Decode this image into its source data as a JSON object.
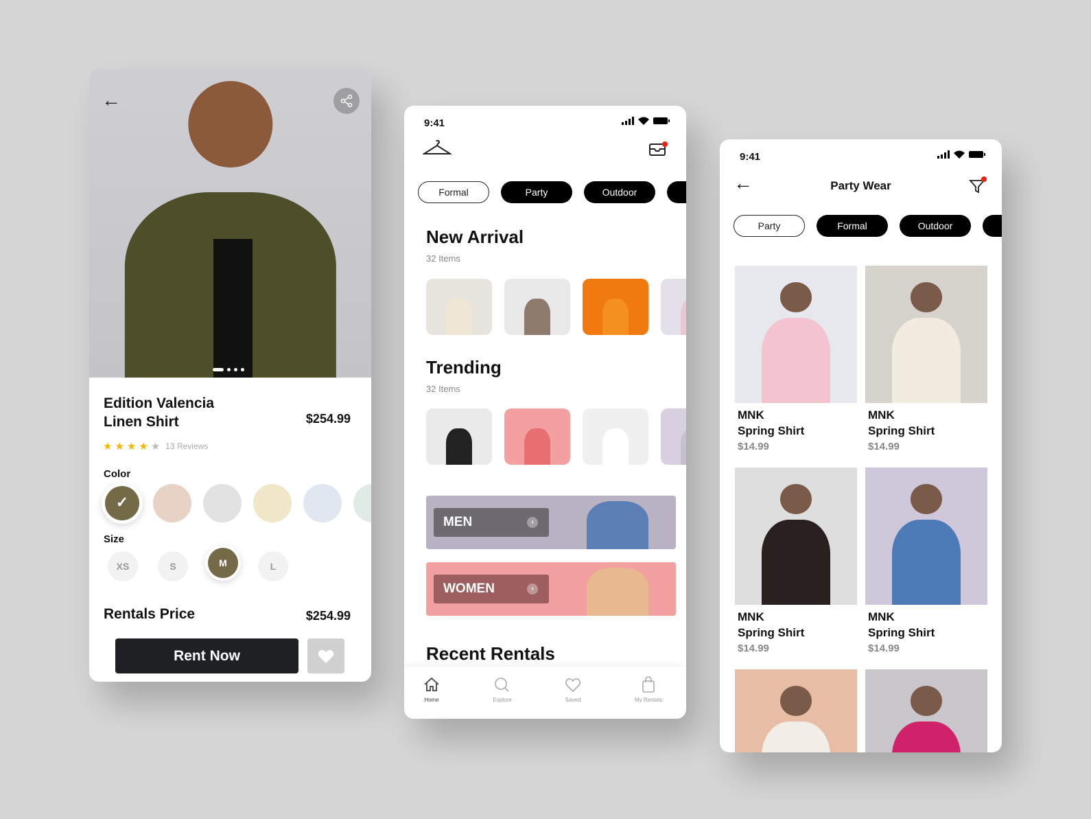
{
  "detail": {
    "title_line1": "Edition Valencia",
    "title_line2": "Linen Shirt",
    "price": "$254.99",
    "rating": 4,
    "rating_max": 5,
    "reviews": "13 Reviews",
    "color_label": "Color",
    "colors": [
      "#756a48",
      "#e8d2c6",
      "#e2e2e2",
      "#efe7c8",
      "#e0e7f1",
      "#dfebe4"
    ],
    "selected_color": 0,
    "size_label": "Size",
    "sizes": [
      "XS",
      "S",
      "M",
      "L"
    ],
    "selected_size": "M",
    "rental_label": "Rentals Price",
    "rental_price": "$254.99",
    "rent_button": "Rent Now",
    "accent": "#756a48",
    "image_dots": 4
  },
  "home": {
    "time": "9:41",
    "chips": [
      "Formal",
      "Party",
      "Outdoor"
    ],
    "new_arrival": {
      "title": "New Arrival",
      "count": "32 Items"
    },
    "trending": {
      "title": "Trending",
      "count": "32 Items"
    },
    "banners": [
      {
        "label": "MEN",
        "color": "#b8b2c2"
      },
      {
        "label": "WOMEN",
        "color": "#f2a0a0"
      }
    ],
    "recent": "Recent Rentals",
    "nav": [
      {
        "label": "Home",
        "icon": "home-icon"
      },
      {
        "label": "Explore",
        "icon": "search-icon"
      },
      {
        "label": "Saved",
        "icon": "heart-icon"
      },
      {
        "label": "My Rentals",
        "icon": "bag-icon"
      }
    ]
  },
  "list": {
    "time": "9:41",
    "title": "Party Wear",
    "chips": [
      "Party",
      "Formal",
      "Outdoor"
    ],
    "items": [
      {
        "brand": "MNK",
        "name": "Spring Shirt",
        "price": "$14.99"
      },
      {
        "brand": "MNK",
        "name": "Spring Shirt",
        "price": "$14.99"
      },
      {
        "brand": "MNK",
        "name": "Spring Shirt",
        "price": "$14.99"
      },
      {
        "brand": "MNK",
        "name": "Spring Shirt",
        "price": "$14.99"
      }
    ]
  }
}
